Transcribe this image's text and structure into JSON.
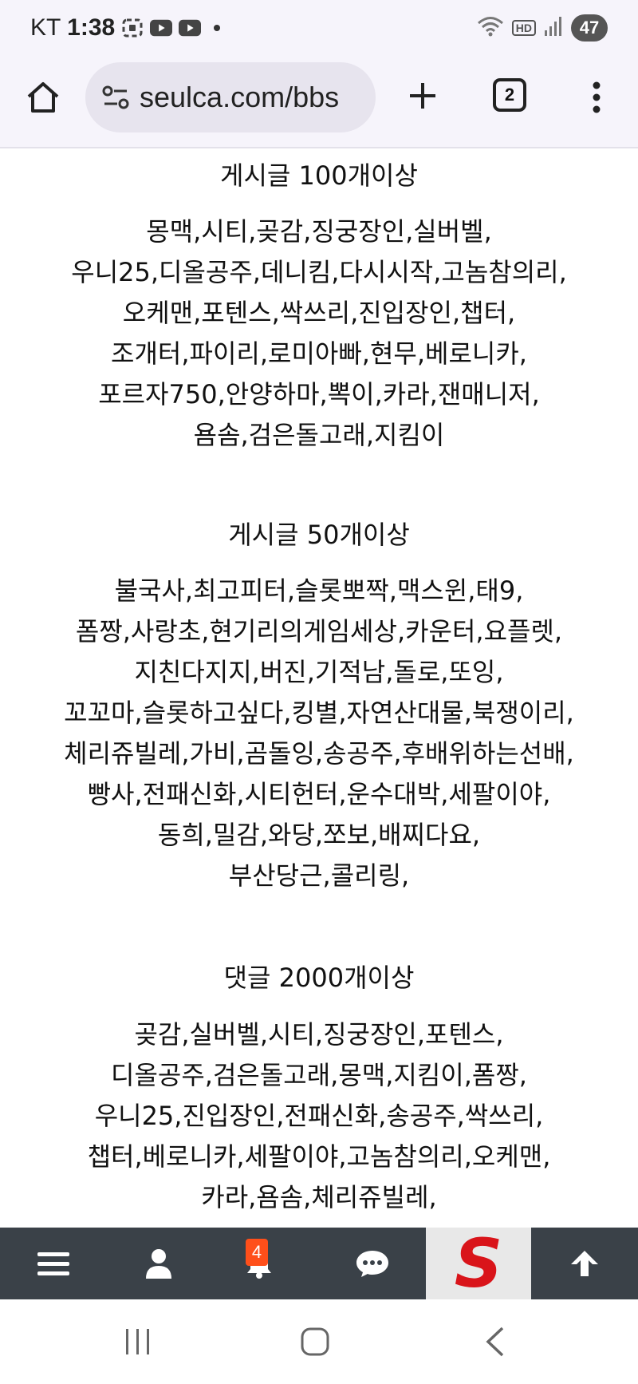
{
  "status_bar": {
    "carrier": "KT",
    "time": "1:38",
    "hd_label": "HD",
    "battery": "47"
  },
  "browser": {
    "url": "seulca.com/bbs",
    "tab_count": "2"
  },
  "sections": [
    {
      "title": "게시글 100개이상",
      "lines": [
        "몽맥,시티,곶감,징궁장인,실버벨,",
        "우니25,디올공주,데니킴,다시시작,고놈참의리,",
        "오케맨,포텐스,싹쓰리,진입장인,챕터,",
        "조개터,파이리,로미아빠,현무,베로니카,",
        "포르자750,안양하마,뽁이,카라,잰매니저,",
        "욤솜,검은돌고래,지킴이"
      ]
    },
    {
      "title": "게시글 50개이상",
      "lines": [
        "불국사,최고피터,슬롯뽀짝,맥스윈,태9,",
        "폼짱,사랑초,현기리의게임세상,카운터,요플렛,",
        "지친다지지,버진,기적남,돌로,또잉,",
        "꼬꼬마,슬롯하고싶다,킹별,자연산대물,북쟁이리,",
        "체리쥬빌레,가비,곰돌잉,송공주,후배위하는선배,",
        "빵사,전패신화,시티헌터,운수대박,세팔이야,",
        "동희,밀감,와당,쪼보,배찌다요,",
        "부산당근,콜리링,"
      ]
    },
    {
      "title": "댓글 2000개이상",
      "lines": [
        "곶감,실버벨,시티,징궁장인,포텐스,",
        "디올공주,검은돌고래,몽맥,지킴이,폼짱,",
        "우니25,진입장인,전패신화,송공주,싹쓰리,",
        "챕터,베로니카,세팔이야,고놈참의리,오케맨,",
        "카라,욤솜,체리쥬빌레,"
      ]
    }
  ],
  "bottom_nav": {
    "notification_count": "4",
    "logo_letter": "S"
  },
  "colors": {
    "bottom_nav_bg": "#3a4148",
    "badge": "#ff4f1a",
    "logo_red": "#d9141a"
  }
}
